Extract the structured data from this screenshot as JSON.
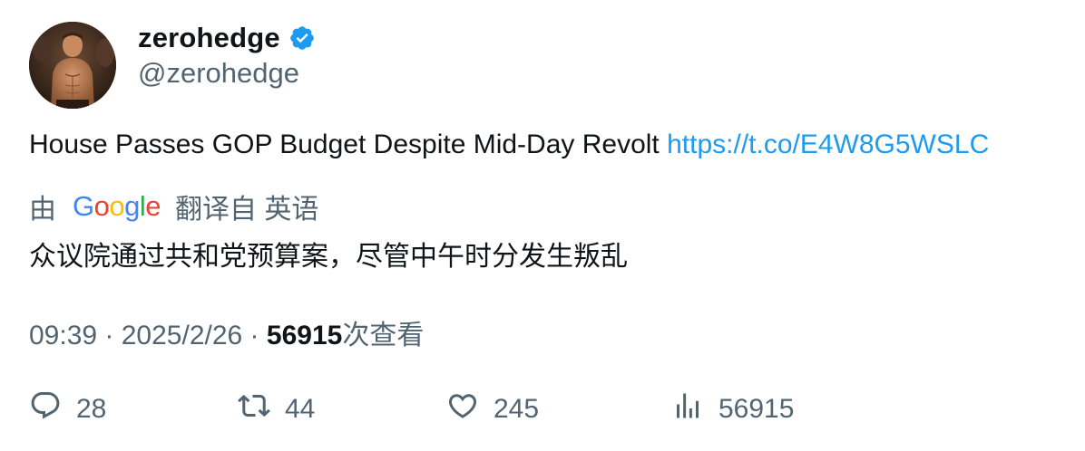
{
  "author": {
    "display_name": "zerohedge",
    "handle": "@zerohedge"
  },
  "tweet": {
    "text": "House Passes GOP Budget Despite Mid-Day Revolt ",
    "link_text": "https://t.co/E4W8G5WSLC"
  },
  "translation": {
    "by_label": "由",
    "provider": "Google",
    "from_label": "翻译自 英语",
    "text": "众议院通过共和党预算案，尽管中午时分发生叛乱"
  },
  "meta": {
    "time": "09:39",
    "separator": " · ",
    "date": "2025/2/26",
    "views_count": "56915",
    "views_label": "次查看"
  },
  "actions": {
    "reply_count": "28",
    "retweet_count": "44",
    "like_count": "245",
    "view_count": "56915"
  },
  "colors": {
    "accent": "#1d9bf0",
    "text": "#0f1419",
    "secondary": "#536471"
  },
  "icons": [
    "verified-badge-icon",
    "reply-icon",
    "retweet-icon",
    "like-icon",
    "views-icon"
  ]
}
